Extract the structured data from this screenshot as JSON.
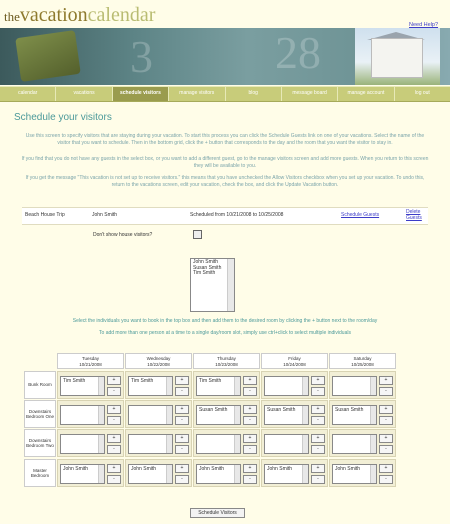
{
  "logo": {
    "the": "the",
    "vacation": "vacation",
    "calendar": "calendar"
  },
  "need_help": "Need Help?",
  "banner_numbers": [
    "3",
    "28"
  ],
  "nav": [
    "calendar",
    "vacations",
    "schedule visitors",
    "manage visitors",
    "blog",
    "message board",
    "manage account",
    "log out"
  ],
  "active_nav": "schedule visitors",
  "page_title": "Schedule your visitors",
  "intro": [
    "Use this screen to specify visitors that are staying during your vacation. To start this process you can click the Schedule Guests link on one of your vacations. Select the name of the visitor that you want to schedule. Then in the bottom grid, click the + button that corresponds to the day and the room that you want the visitor to stay in.",
    "If you find that you do not have any guests in the select box, or you want to add a different guest, go to the manage visitors screen and add more guests. When you return to this screen they will be available to you.",
    "If you get the message \"This vacation is not set up to receive visitors.\" this means that you have unchecked the Allow Visitors checkbox when you set up your vacation. To undo this, return to the vacations screen, edit your vacation, check the box, and click the Update Vacation button."
  ],
  "trip": {
    "name": "Beach House Trip",
    "owner": "John Smith",
    "dates": "Scheduled from 10/21/2008 to 10/25/2008",
    "schedule_link": "Schedule Guests",
    "delete_link": "Delete Guests"
  },
  "dont_show_label": "Don't show house visitors?",
  "guests": [
    "John Smith",
    "Susan Smith",
    "Tim Smith"
  ],
  "instruction1": "Select the individuals you want to book in the top box and then add them to the desired room by clicking the + button next to the room/day",
  "instruction2": "To add more than one person at a time to a single day/room slot, simply use ctrl+click to select multiple individuals",
  "days": [
    {
      "name": "Tuesday",
      "date": "10/21/2008"
    },
    {
      "name": "Wednesday",
      "date": "10/22/2008"
    },
    {
      "name": "Thursday",
      "date": "10/23/2008"
    },
    {
      "name": "Friday",
      "date": "10/24/2008"
    },
    {
      "name": "Saturday",
      "date": "10/25/2008"
    }
  ],
  "rooms": [
    {
      "name": "Bunk Room",
      "slots": [
        "Tim Smith",
        "Tim Smith",
        "Tim Smith",
        "",
        ""
      ]
    },
    {
      "name": "Downstairs Bedroom One",
      "slots": [
        "",
        "",
        "Susan Smith",
        "Susan Smith",
        "Susan Smith"
      ]
    },
    {
      "name": "Downstairs Bedroom Two",
      "slots": [
        "",
        "",
        "",
        "",
        ""
      ]
    },
    {
      "name": "Master Bedroom",
      "slots": [
        "John Smith",
        "John Smith",
        "John Smith",
        "John Smith",
        "John Smith"
      ]
    }
  ],
  "plus": "+",
  "minus": "-",
  "submit_label": "Schedule Visitors"
}
